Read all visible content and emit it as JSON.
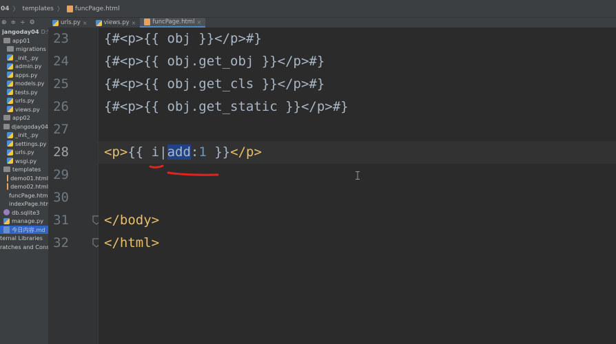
{
  "breadcrumb": {
    "project": "04",
    "folder": "templates",
    "file": "funcPage.html"
  },
  "sidebar": {
    "items": [
      {
        "label": "jangoday04",
        "suffix": "D:\\pyth",
        "kind": "folder"
      },
      {
        "label": "app01",
        "kind": "folder"
      },
      {
        "label": "migrations",
        "kind": "folder"
      },
      {
        "label": "_init_.py",
        "kind": "py"
      },
      {
        "label": "admin.py",
        "kind": "py"
      },
      {
        "label": "apps.py",
        "kind": "py"
      },
      {
        "label": "models.py",
        "kind": "py"
      },
      {
        "label": "tests.py",
        "kind": "py"
      },
      {
        "label": "urls.py",
        "kind": "py"
      },
      {
        "label": "views.py",
        "kind": "py"
      },
      {
        "label": "app02",
        "kind": "folder"
      },
      {
        "label": "djangoday04",
        "kind": "folder"
      },
      {
        "label": "_init_.py",
        "kind": "py"
      },
      {
        "label": "settings.py",
        "kind": "py"
      },
      {
        "label": "urls.py",
        "kind": "py"
      },
      {
        "label": "wsgi.py",
        "kind": "py"
      },
      {
        "label": "templates",
        "kind": "folder"
      },
      {
        "label": "demo01.html",
        "kind": "html"
      },
      {
        "label": "demo02.html",
        "kind": "html"
      },
      {
        "label": "funcPage.html",
        "kind": "html"
      },
      {
        "label": "indexPage.html",
        "kind": "html"
      },
      {
        "label": "db.sqlite3",
        "kind": "db"
      },
      {
        "label": "manage.py",
        "kind": "py"
      },
      {
        "label": "今日内容.md",
        "kind": "md"
      },
      {
        "label": "ternal Libraries",
        "kind": "lib"
      },
      {
        "label": "ratches and Consol",
        "kind": "lib"
      }
    ]
  },
  "tabs": [
    {
      "label": "urls.py",
      "close": "×",
      "kind": "py",
      "active": false
    },
    {
      "label": "views.py",
      "close": "×",
      "kind": "py",
      "active": false
    },
    {
      "label": "funcPage.html",
      "close": "×",
      "kind": "html",
      "active": true
    }
  ],
  "editor": {
    "lines": [
      {
        "num": "23",
        "text": "{#<p>{{ obj }}</p>#}"
      },
      {
        "num": "24",
        "text": "{#<p>{{ obj.get_obj }}</p>#}"
      },
      {
        "num": "25",
        "text": "{#<p>{{ obj.get_cls }}</p>#}"
      },
      {
        "num": "26",
        "text": "{#<p>{{ obj.get_static }}</p>#}"
      },
      {
        "num": "27",
        "text": ""
      },
      {
        "num": "28",
        "text": "<p>{{ i|add:1 }}</p>"
      },
      {
        "num": "29",
        "text": ""
      },
      {
        "num": "30",
        "text": ""
      },
      {
        "num": "31",
        "text": "</body>"
      },
      {
        "num": "32",
        "text": "</html>"
      }
    ],
    "current_line": "28",
    "line28_parts": {
      "open_tag": "<p>",
      "open_brace": "{{ ",
      "var": "i",
      "pipe": "|",
      "filter": "add",
      "colon": ":",
      "arg": "1",
      "close_brace": " }}",
      "close_tag": "</p>"
    }
  },
  "colors": {
    "editor_bg": "#2b2b2b",
    "gutter_bg": "#313335",
    "tag": "#e8bf6a",
    "text": "#a9b7c6",
    "number": "#6897bb",
    "selection": "#214283",
    "annotation": "#e0241f"
  }
}
